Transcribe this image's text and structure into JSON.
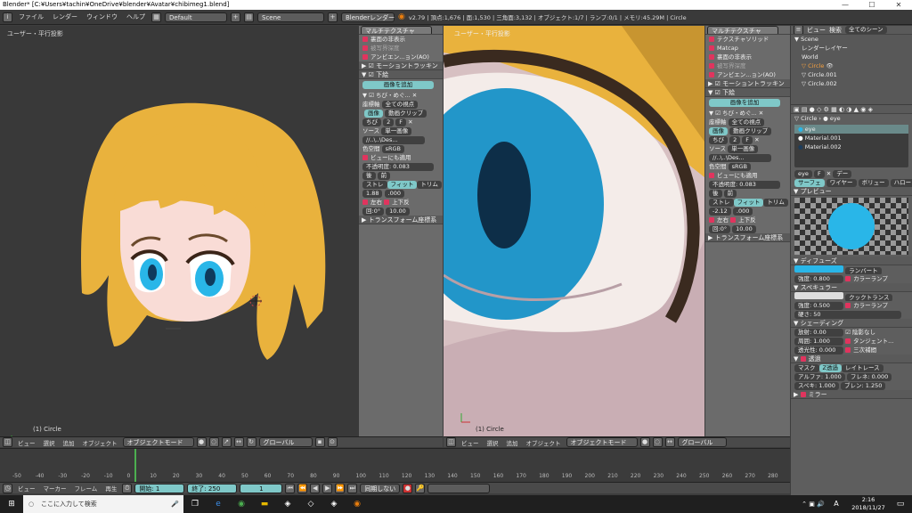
{
  "window": {
    "title": "Blender* [C:¥Users¥tachin¥OneDrive¥blender¥Avatar¥chibimeg1.blend]",
    "minimize": "—",
    "maximize": "☐",
    "close": "✕"
  },
  "topbar": {
    "menus": [
      "ファイル",
      "レンダー",
      "ウィンドウ",
      "ヘルプ"
    ],
    "layout": "Default",
    "scene": "Scene",
    "engine": "Blenderレンダー",
    "stats": "v2.79 | 頂点:1,676 | 面:1,530 | 三角面:3,132 | オブジェクト:1/7 | ランプ:0/1 | メモリ:45.29M | Circle"
  },
  "viewport_left": {
    "label": "ユーザー・平行投影",
    "object": "(1) Circle"
  },
  "viewport_right": {
    "label": "ユーザー・平行投影",
    "object": "(1) Circle"
  },
  "vp_header": {
    "menus": [
      "ビュー",
      "選択",
      "追加",
      "オブジェクト"
    ],
    "mode": "オブジェクトモード",
    "orientation": "グローバル"
  },
  "tool_panel": {
    "matcap_header": "マルチテクスチャ",
    "opt1": "裏面の非表示",
    "opt2": "被写界深度",
    "opt3": "アンビエン...ョン(AO)",
    "motion": "モーショントラッキン",
    "underlay": "下絵",
    "add_image": "画像を追加",
    "img_name": "ちび・めぐ...",
    "axis_label": "座標軸",
    "axis_value": "全ての視点",
    "tab_image": "画像",
    "tab_movie": "動画クリップ",
    "img_field": "ちび",
    "img_count": "2",
    "img_f": "F",
    "source_label": "ソース",
    "source_value": "単一画像",
    "path": "//..\\..\\Des...",
    "colorspace_label": "色空間",
    "colorspace_value": "sRGB",
    "view_apply": "ビューにも適用",
    "opacity": "不透明度:",
    "opacity_val": "0.083",
    "back": "後",
    "front": "前",
    "stretch": "ストレ",
    "fit": "フィット",
    "crop": "トリム",
    "x_val": "1.88",
    "y_val": ".000",
    "flip_x": "左右",
    "flip_y": "上下反",
    "rot": "回:0°",
    "size": "10.00",
    "transform": "トランスフォーム座標系"
  },
  "tool_panel2": {
    "matcap_header": "マルチテクスチャ",
    "opt0": "テクスチャソリッド",
    "opt1": "Matcap",
    "opt2": "裏面の非表示",
    "opt3": "被写界深度",
    "opt4": "アンビエン...ョン(AO)",
    "motion": "モーショントラッキン",
    "underlay": "下絵",
    "add_image": "画像を追加",
    "img_name": "ちび・めぐ...",
    "axis_value": "全ての視点",
    "x_val": "-2.12",
    "y_val": ".000",
    "opacity_val": "0.083",
    "rot": "回:0°",
    "size": "10.00"
  },
  "outliner": {
    "menus": [
      "ビュー",
      "検索"
    ],
    "filter": "全てのシーン",
    "items": [
      "Scene",
      "レンダーレイヤー",
      "World",
      "Circle",
      "Circle.001",
      "Circle.002"
    ]
  },
  "properties": {
    "breadcrumb_obj": "Circle",
    "breadcrumb_mat": "eye",
    "materials": [
      "eye",
      "Material.001",
      "Material.002"
    ],
    "mat_name": "eye",
    "mat_f": "F",
    "data_btn": "デー",
    "tabs": [
      "サーフェ",
      "ワイヤー",
      "ボリュー",
      "ハロー"
    ],
    "preview": "プレビュー",
    "diffuse": "ディフューズ",
    "diffuse_shader": "ランバート",
    "intensity_label": "強度:",
    "diffuse_int": "0.800",
    "ramp": "カラーランプ",
    "specular": "スペキュラー",
    "spec_shader": "クックトランス",
    "spec_int": "0.500",
    "hardness": "硬さ:",
    "hardness_val": "50",
    "shading": "シェーディング",
    "emit": "放射:",
    "emit_val": "0.00",
    "shadeless": "陰影なし",
    "ambient": "周囲:",
    "ambient_val": "1.000",
    "tangent": "タンジェント...",
    "translucency": "透光性:",
    "trans_val": "0.000",
    "cubic": "三次補間",
    "transparency": "透過",
    "mask": "マスク",
    "ztransp": "Z透過",
    "raytrace": "レイトレース",
    "alpha": "アルファ:",
    "alpha_val": "1.000",
    "fresnel": "フレネ:",
    "fresnel_val": "0.000",
    "specular2": "スペキ:",
    "spec2_val": "1.000",
    "blend": "ブレン:",
    "blend_val": "1.250",
    "mirror": "ミラー"
  },
  "timeline": {
    "ticks": [
      "-50",
      "-40",
      "-30",
      "-20",
      "-10",
      "0",
      "10",
      "20",
      "30",
      "40",
      "50",
      "60",
      "70",
      "80",
      "90",
      "100",
      "110",
      "120",
      "130",
      "140",
      "150",
      "160",
      "170",
      "180",
      "190",
      "200",
      "210",
      "220",
      "230",
      "240",
      "250",
      "260",
      "270",
      "280"
    ],
    "menus": [
      "ビュー",
      "マーカー",
      "フレーム",
      "再生"
    ],
    "start": "開始:",
    "start_val": "1",
    "end": "終了:",
    "end_val": "250",
    "current": "1",
    "sync": "同期しない"
  },
  "taskbar": {
    "search": "ここに入力して検索",
    "time": "2:16",
    "date": "2018/11/27",
    "ime": "A"
  },
  "colors": {
    "eye_blue": "#29b6e8",
    "hair": "#e9b23d",
    "skin": "#f9dcd6",
    "accent": "#7fc8c8",
    "check": "#e0345e"
  }
}
